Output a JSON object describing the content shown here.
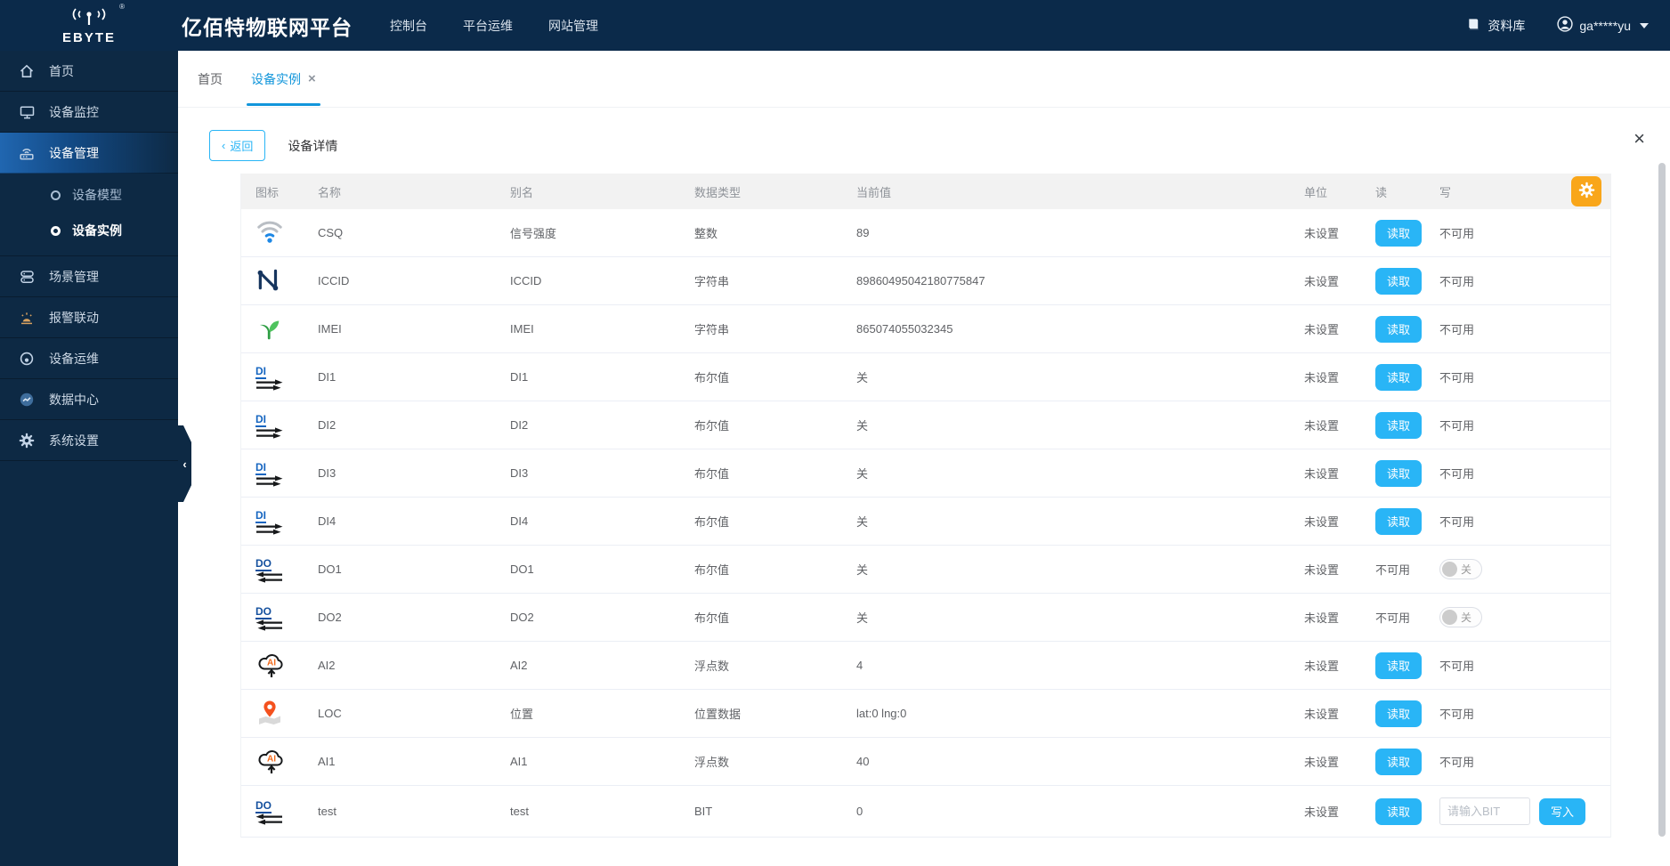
{
  "navbar": {
    "logo": {
      "brand": "EBYTE",
      "reg_mark": "®"
    },
    "title": "亿佰特物联网平台",
    "menu": [
      {
        "id": "console",
        "label": "控制台"
      },
      {
        "id": "platform-ops",
        "label": "平台运维"
      },
      {
        "id": "site-management",
        "label": "网站管理"
      }
    ],
    "library_label": "资料库",
    "username": "ga*****yu"
  },
  "sidebar": {
    "collapse_arrow": "‹",
    "items": [
      {
        "id": "home",
        "icon": "home-icon",
        "label": "首页",
        "active": false
      },
      {
        "id": "device-monitor",
        "icon": "monitor-icon",
        "label": "设备监控",
        "active": false
      },
      {
        "id": "device-management",
        "icon": "router-icon",
        "label": "设备管理",
        "active": true,
        "children": [
          {
            "id": "device-model",
            "label": "设备模型",
            "active": false
          },
          {
            "id": "device-instance",
            "label": "设备实例",
            "active": true
          }
        ]
      },
      {
        "id": "scene-management",
        "icon": "layers-icon",
        "label": "场景管理",
        "active": false
      },
      {
        "id": "alarm-linkage",
        "icon": "alarm-icon",
        "label": "报警联动",
        "active": false
      },
      {
        "id": "device-ops",
        "icon": "target-icon",
        "label": "设备运维",
        "active": false
      },
      {
        "id": "data-center",
        "icon": "chart-icon",
        "label": "数据中心",
        "active": false
      },
      {
        "id": "system-settings",
        "icon": "gear-icon",
        "label": "系统设置",
        "active": false
      }
    ]
  },
  "tabs": [
    {
      "id": "home",
      "label": "首页",
      "active": false,
      "closable": false
    },
    {
      "id": "device-instance",
      "label": "设备实例",
      "active": true,
      "closable": true
    }
  ],
  "toolbar": {
    "back_arrow": "‹",
    "back_label": "返回",
    "title": "设备详情",
    "close_icon": "×",
    "tab_close_icon": "×"
  },
  "table": {
    "headers": [
      {
        "key": "icon",
        "label": "图标"
      },
      {
        "key": "name",
        "label": "名称"
      },
      {
        "key": "alias",
        "label": "别名"
      },
      {
        "key": "type",
        "label": "数据类型"
      },
      {
        "key": "value",
        "label": "当前值"
      },
      {
        "key": "unit",
        "label": "单位"
      },
      {
        "key": "read",
        "label": "读"
      },
      {
        "key": "write",
        "label": "写"
      }
    ],
    "labels": {
      "read_button": "读取",
      "write_button": "写入",
      "unavailable": "不可用",
      "toggle_off": "关",
      "input_placeholder": "请输入BIT"
    },
    "rows": [
      {
        "icon": "wifi-icon",
        "name": "CSQ",
        "alias": "信号强度",
        "type": "整数",
        "value": "89",
        "unit": "未设置",
        "read": "button",
        "write": "unavailable"
      },
      {
        "icon": "iccid-icon",
        "name": "ICCID",
        "alias": "ICCID",
        "type": "字符串",
        "value": "89860495042180775847",
        "unit": "未设置",
        "read": "button",
        "write": "unavailable"
      },
      {
        "icon": "sprout-icon",
        "name": "IMEI",
        "alias": "IMEI",
        "type": "字符串",
        "value": "865074055032345",
        "unit": "未设置",
        "read": "button",
        "write": "unavailable"
      },
      {
        "icon": "di-icon",
        "name": "DI1",
        "alias": "DI1",
        "type": "布尔值",
        "value": "关",
        "unit": "未设置",
        "read": "button",
        "write": "unavailable"
      },
      {
        "icon": "di-icon",
        "name": "DI2",
        "alias": "DI2",
        "type": "布尔值",
        "value": "关",
        "unit": "未设置",
        "read": "button",
        "write": "unavailable"
      },
      {
        "icon": "di-icon",
        "name": "DI3",
        "alias": "DI3",
        "type": "布尔值",
        "value": "关",
        "unit": "未设置",
        "read": "button",
        "write": "unavailable"
      },
      {
        "icon": "di-icon",
        "name": "DI4",
        "alias": "DI4",
        "type": "布尔值",
        "value": "关",
        "unit": "未设置",
        "read": "button",
        "write": "unavailable"
      },
      {
        "icon": "do-icon",
        "name": "DO1",
        "alias": "DO1",
        "type": "布尔值",
        "value": "关",
        "unit": "未设置",
        "read": "unavailable",
        "write": "toggle"
      },
      {
        "icon": "do-icon",
        "name": "DO2",
        "alias": "DO2",
        "type": "布尔值",
        "value": "关",
        "unit": "未设置",
        "read": "unavailable",
        "write": "toggle"
      },
      {
        "icon": "ai-icon",
        "name": "AI2",
        "alias": "AI2",
        "type": "浮点数",
        "value": "4",
        "unit": "未设置",
        "read": "button",
        "write": "unavailable"
      },
      {
        "icon": "loc-icon",
        "name": "LOC",
        "alias": "位置",
        "type": "位置数据",
        "value": "lat:0 lng:0",
        "unit": "未设置",
        "read": "button",
        "write": "unavailable"
      },
      {
        "icon": "ai-icon",
        "name": "AI1",
        "alias": "AI1",
        "type": "浮点数",
        "value": "40",
        "unit": "未设置",
        "read": "button",
        "write": "unavailable"
      },
      {
        "icon": "do-icon",
        "name": "test",
        "alias": "test",
        "type": "BIT",
        "value": "0",
        "unit": "未设置",
        "read": "button",
        "write": "input"
      }
    ]
  },
  "colors": {
    "navbar_bg": "#0b2a4a",
    "sidebar_bg": "#0d2944",
    "tab_blue": "#1296db",
    "button_blue": "#29b5f6",
    "gear_orange": "#f9a61a",
    "header_bg": "#f2f2f2"
  }
}
